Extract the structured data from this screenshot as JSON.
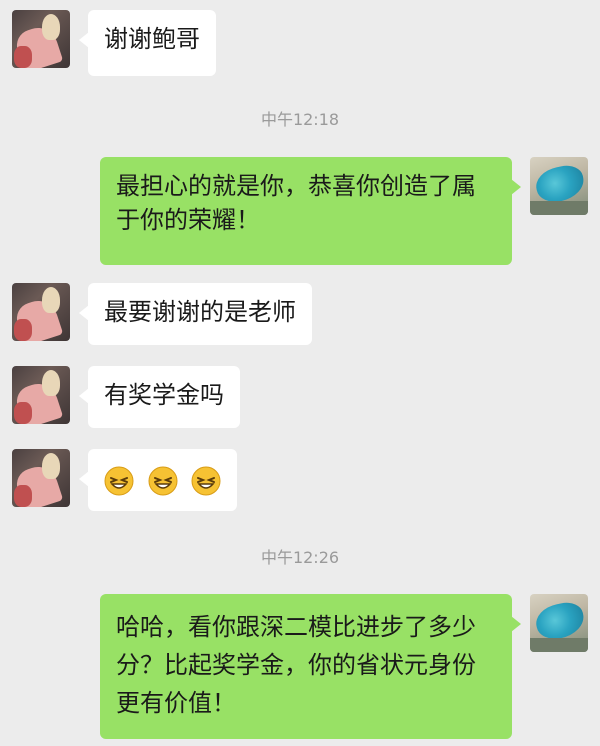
{
  "messages": {
    "m1": {
      "text": "谢谢鲍哥"
    },
    "t1": {
      "text": "中午12:18"
    },
    "m2": {
      "text": "最担心的就是你，恭喜你创造了属于你的荣耀！"
    },
    "m3": {
      "text": "最要谢谢的是老师"
    },
    "m4": {
      "text": "有奖学金吗"
    },
    "m5": {
      "emoji_count": 3,
      "emoji_icon": "grin-emoji-icon"
    },
    "t2": {
      "text": "中午12:26"
    },
    "m6": {
      "text": "哈哈，看你跟深二模比进步了多少分？比起奖学金，你的省状元身份更有价值！"
    }
  },
  "colors": {
    "background": "#ececec",
    "incoming_bubble": "#ffffff",
    "outgoing_bubble": "#98e165",
    "timestamp": "#9a9a9a"
  }
}
